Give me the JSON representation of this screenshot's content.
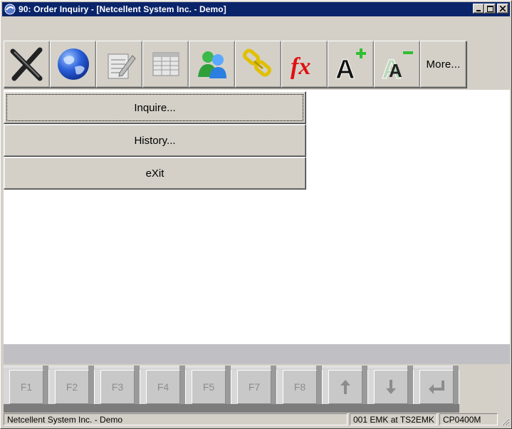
{
  "window": {
    "title": "90: Order Inquiry - [Netcellent System Inc. - Demo]",
    "title_bar_color": "#0a246a"
  },
  "toolbar": {
    "items": [
      {
        "id": "exit",
        "icon": "close-x-icon"
      },
      {
        "id": "web",
        "icon": "globe-icon"
      },
      {
        "id": "edit",
        "icon": "notepad-pencil-icon"
      },
      {
        "id": "grid",
        "icon": "spreadsheet-icon"
      },
      {
        "id": "users",
        "icon": "users-icon"
      },
      {
        "id": "link",
        "icon": "chain-link-icon"
      },
      {
        "id": "function",
        "icon": "fx-icon"
      },
      {
        "id": "font-larger",
        "icon": "font-increase-icon"
      },
      {
        "id": "font-smaller",
        "icon": "font-decrease-icon"
      }
    ],
    "more_label": "More..."
  },
  "menu": {
    "items": [
      {
        "label": "Inquire..."
      },
      {
        "label": "History..."
      },
      {
        "label": "eXit"
      }
    ]
  },
  "function_keys": {
    "keys": [
      "F1",
      "F2",
      "F3",
      "F4",
      "F5",
      "F7",
      "F8"
    ],
    "arrow_icons": [
      "arrow-up-icon",
      "arrow-down-icon",
      "enter-icon"
    ]
  },
  "status_bar": {
    "company": "Netcellent System Inc. - Demo",
    "user": "001 EMK at TS2EMK",
    "program": "CP0400M"
  }
}
